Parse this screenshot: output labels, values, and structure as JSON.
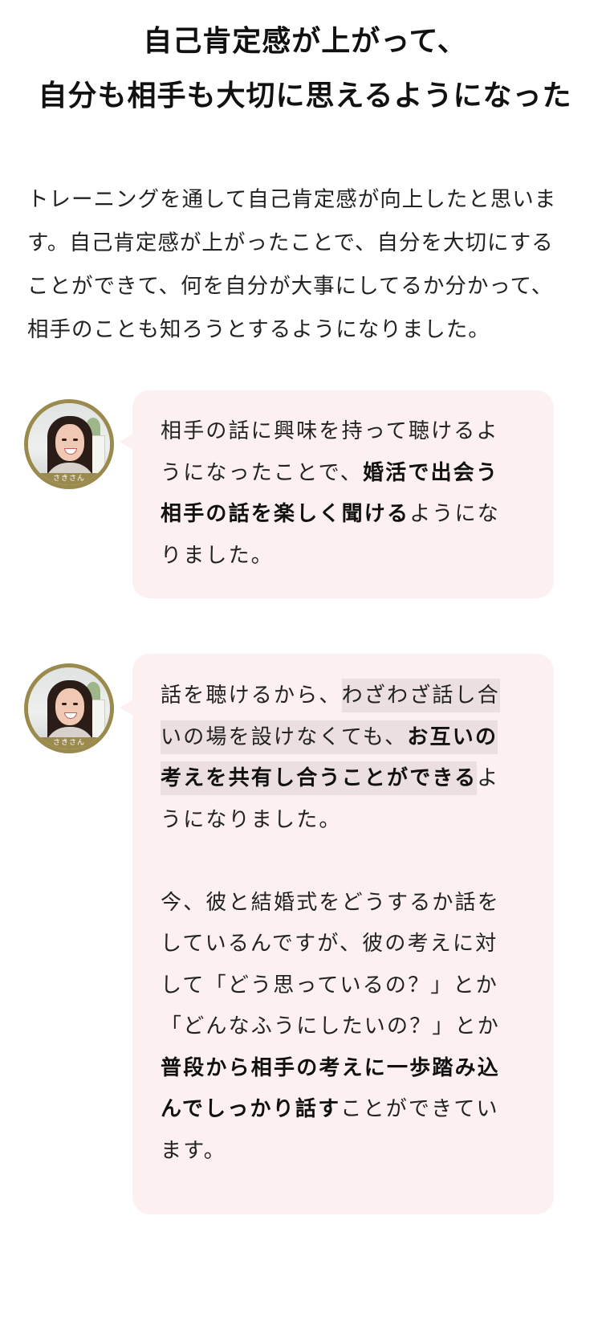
{
  "heading": {
    "line1": "自己肯定感が上がって、",
    "line2": "自分も相手も大切に思えるようになった"
  },
  "intro": [
    "トレーニングを通して自己肯定感が向上したと思いま",
    "す。自己肯定感が上がったことで、自分を大切にする",
    "ことができて、何を自分が大事にしてるか分かって、",
    "相手のことも知ろうとするようになりました。"
  ],
  "avatar": {
    "name_label": "さきさん"
  },
  "bubble1": {
    "l1": "相手の話に興味を持って聴けるよ",
    "l2a": "うになったことで、",
    "l2b": "婚活で出会う",
    "l3a": "相手の話を楽しく聞ける",
    "l3b": "ようにな",
    "l4": "りました。"
  },
  "bubble2": {
    "l1a": "話を聴けるから、",
    "l1b": "わざわざ話し合",
    "l2a": "いの場を設けなくても、",
    "l2b": "お互いの",
    "l3a": "考えを共有し合うことができる",
    "l3b": "よ",
    "l4": "うになりました。",
    "l5": "今、彼と結婚式をどうするか話を",
    "l6": "しているんですが、彼の考えに対",
    "l7": "して「どう思っているの？」とか",
    "l8": "「どんなふうにしたいの？」とか",
    "l9": "普段から相手の考えに一歩踏み込",
    "l10a": "んでしっかり話す",
    "l10b": "ことができてい",
    "l11": "ます。"
  },
  "colors": {
    "bubble_bg": "#fcf0f0",
    "highlight": "#ecdfe0",
    "avatar_ring": "#9a8a4e"
  }
}
